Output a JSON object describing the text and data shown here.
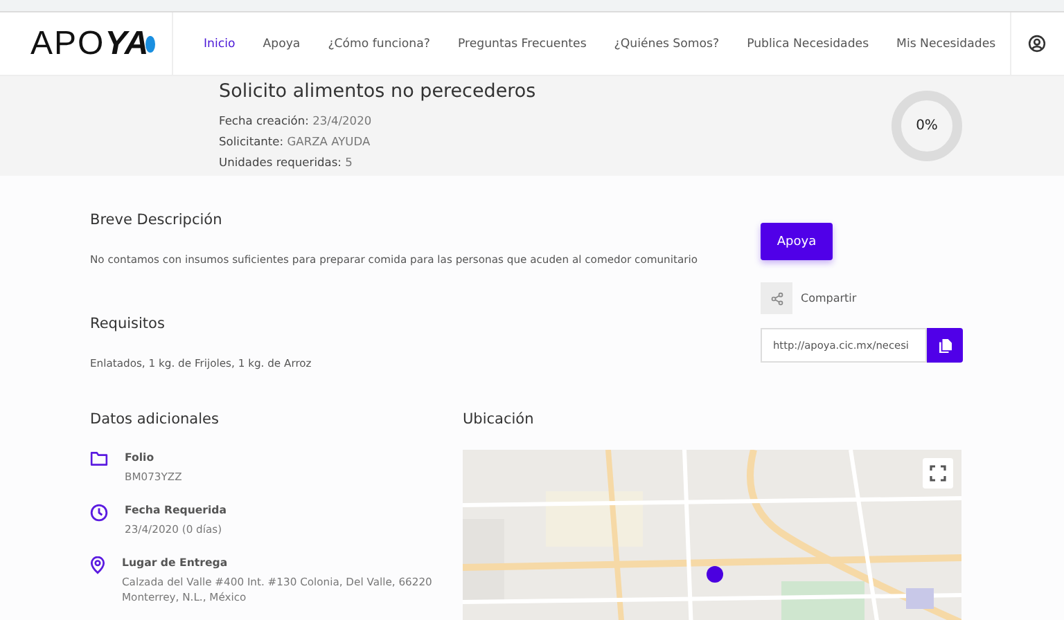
{
  "logo": {
    "text": "APO",
    "mark": "YA"
  },
  "nav": [
    {
      "label": "Inicio",
      "selected": true
    },
    {
      "label": "Apoya",
      "selected": false
    },
    {
      "label": "¿Cómo funciona?",
      "selected": false
    },
    {
      "label": "Preguntas Frecuentes",
      "selected": false
    },
    {
      "label": "¿Quiénes Somos?",
      "selected": false
    },
    {
      "label": "Publica Necesidades",
      "selected": false
    },
    {
      "label": "Mis Necesidades",
      "selected": false
    }
  ],
  "request": {
    "title": "Solicito alimentos no perecederos",
    "facts": [
      {
        "label": "Fecha creación:",
        "value": "23/4/2020"
      },
      {
        "label": "Solicitante:",
        "value": "GARZA AYUDA"
      },
      {
        "label": "Unidades requeridas:",
        "value": "5"
      }
    ],
    "progress": {
      "level": 0,
      "text": "0%"
    }
  },
  "description": {
    "heading": "Breve Descripción",
    "text": "No contamos con insumos suficientes para preparar comida para las personas que acuden al comedor comunitario"
  },
  "requirements": {
    "heading": "Requisitos",
    "text": "Enlatados, 1 kg. de Frijoles, 1 kg. de Arroz"
  },
  "support_button": "Apoya",
  "share": {
    "label": "Compartir",
    "link": "http://apoya.cic.mx/necesi"
  },
  "additional": {
    "heading": "Datos adicionales",
    "items": [
      {
        "kind": "folder",
        "label": "Folio",
        "value": "BM073YZZ"
      },
      {
        "kind": "clock",
        "label": "Fecha Requerida",
        "value": "23/4/2020 (0 días)"
      },
      {
        "kind": "pin",
        "label": "Lugar de Entrega",
        "value": "Calzada del Valle #400 Int. #130 Colonia, Del Valle, 66220 Monterrey, N.L., México"
      }
    ]
  },
  "location": {
    "heading": "Ubicación"
  }
}
